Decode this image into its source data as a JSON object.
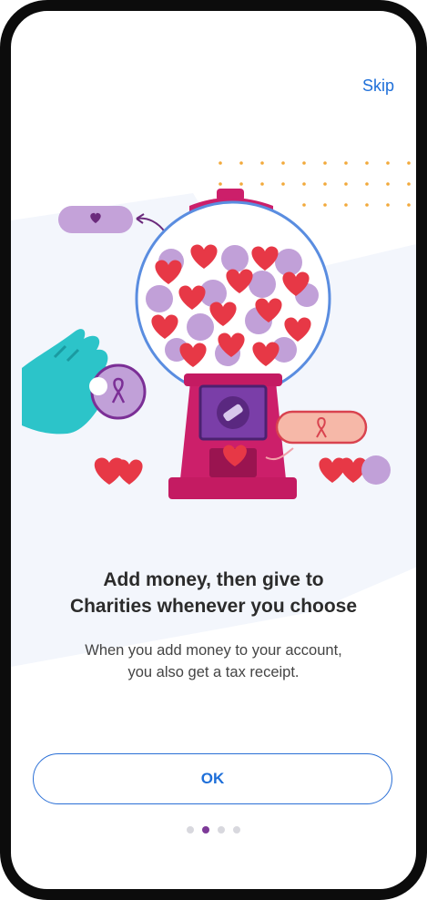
{
  "header": {
    "skip_label": "Skip"
  },
  "onboarding": {
    "title_line1": "Add money, then give to",
    "title_line2": "Charities whenever you choose",
    "subtitle_line1": "When you add money to your account,",
    "subtitle_line2": "you also get a tax receipt."
  },
  "actions": {
    "ok_label": "OK"
  },
  "pager": {
    "total": 4,
    "active_index": 1
  },
  "colors": {
    "accent_blue": "#1e6fd9",
    "machine_pink": "#cc1f6a",
    "heart_red": "#e73846",
    "lavender": "#c1a0d8",
    "teal_hand": "#2cc4c9",
    "active_dot": "#7d3a98"
  },
  "icons": {
    "heart_tag": "heart-icon",
    "ribbon_coin": "ribbon-icon",
    "ribbon_tag": "ribbon-icon"
  }
}
